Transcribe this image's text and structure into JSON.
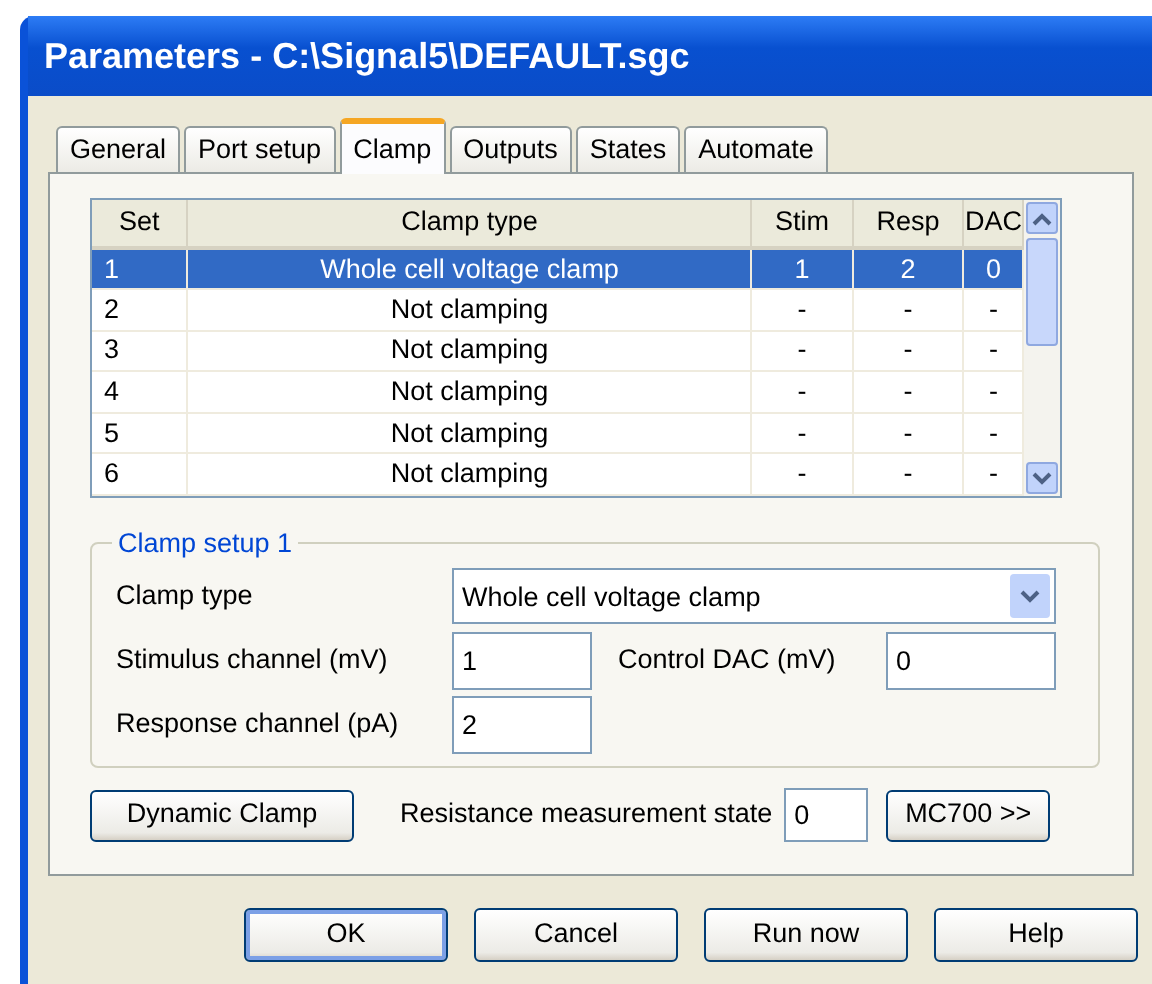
{
  "window": {
    "title": "Parameters - C:\\Signal5\\DEFAULT.sgc"
  },
  "tabs": [
    {
      "label": "General",
      "selected": false
    },
    {
      "label": "Port setup",
      "selected": false
    },
    {
      "label": "Clamp",
      "selected": true
    },
    {
      "label": "Outputs",
      "selected": false
    },
    {
      "label": "States",
      "selected": false
    },
    {
      "label": "Automate",
      "selected": false
    }
  ],
  "table": {
    "columns": [
      "Set",
      "Clamp type",
      "Stim",
      "Resp",
      "DAC"
    ],
    "rows": [
      {
        "cells": [
          "1",
          "Whole cell voltage clamp",
          "1",
          "2",
          "0"
        ],
        "selected": true
      },
      {
        "cells": [
          "2",
          "Not clamping",
          "-",
          "-",
          "-"
        ],
        "selected": false
      },
      {
        "cells": [
          "3",
          "Not clamping",
          "-",
          "-",
          "-"
        ],
        "selected": false
      },
      {
        "cells": [
          "4",
          "Not clamping",
          "-",
          "-",
          "-"
        ],
        "selected": false
      },
      {
        "cells": [
          "5",
          "Not clamping",
          "-",
          "-",
          "-"
        ],
        "selected": false
      },
      {
        "cells": [
          "6",
          "Not clamping",
          "-",
          "-",
          "-"
        ],
        "selected": false
      }
    ]
  },
  "clamp_setup": {
    "title": "Clamp setup 1",
    "clamp_type": {
      "label": "Clamp type",
      "value": "Whole cell voltage clamp"
    },
    "stimulus_channel": {
      "label": "Stimulus channel (mV)",
      "value": "1"
    },
    "control_dac": {
      "label": "Control DAC (mV)",
      "value": "0"
    },
    "response_channel": {
      "label": "Response channel (pA)",
      "value": "2"
    }
  },
  "dynamic_clamp_button": "Dynamic Clamp",
  "resistance_state": {
    "label": "Resistance measurement state",
    "value": "0"
  },
  "mc700_button": "MC700 >>",
  "buttons": [
    {
      "label": "OK",
      "default": true
    },
    {
      "label": "Cancel",
      "default": false
    },
    {
      "label": "Run now",
      "default": false
    },
    {
      "label": "Help",
      "default": false
    }
  ]
}
